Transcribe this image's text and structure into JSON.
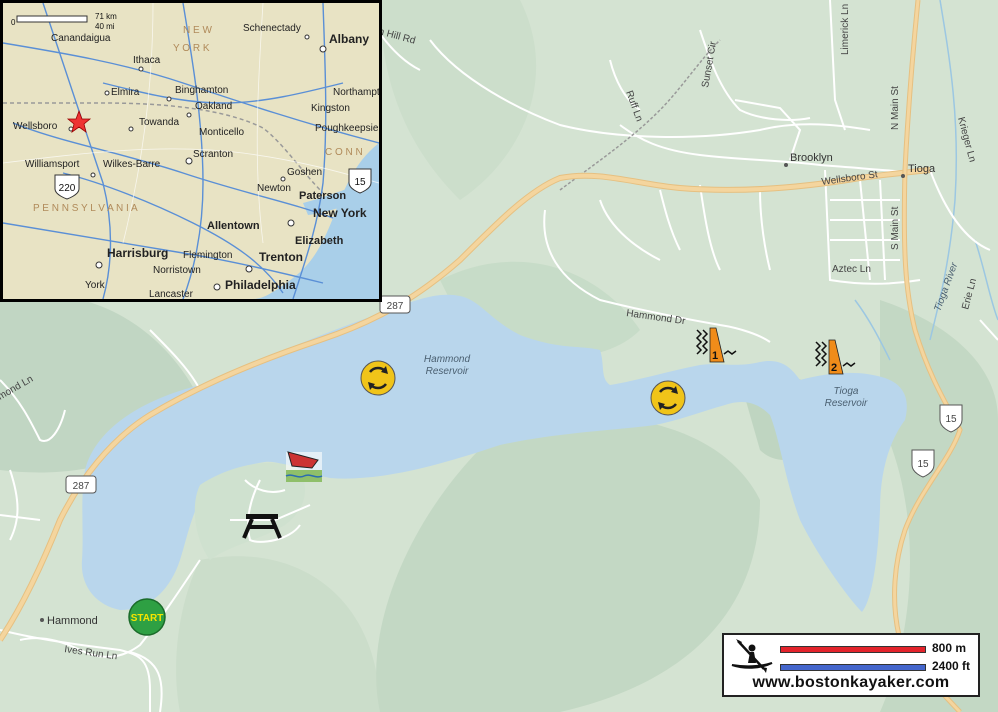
{
  "map": {
    "places": {
      "hammond": "Hammond",
      "brooklyn": "Brooklyn",
      "tioga": "Tioga"
    },
    "water": {
      "hammond_res_line1": "Hammond",
      "hammond_res_line2": "Reservoir",
      "tioga_res_line1": "Tioga",
      "tioga_res_line2": "Reservoir",
      "tioga_river": "Tioga River"
    },
    "roads": {
      "hammond_dr": "Hammond Dr",
      "ives_run": "Ives Run Ln",
      "wellsboro_st": "Wellsboro St",
      "n_main_st": "N Main St",
      "s_main_st": "S Main St",
      "aztec_ln": "Aztec Ln",
      "erie_ln": "Erie Ln",
      "krieger_ln": "Krieger Ln",
      "limerick_ln": "Limerick Ln",
      "sunset_cir": "Sunset Cir",
      "ruff_ln": "Ruff Ln",
      "hill_rd": "n Hill Rd",
      "hammond_ln": "mond Ln",
      "route_287": "287",
      "route_15": "15"
    },
    "markers": {
      "start": "START",
      "dam1": "1",
      "dam2": "2"
    }
  },
  "inset": {
    "scale_km": "71 km",
    "scale_mi": "40 mi",
    "scale_zero": "0",
    "states": {
      "new_york": "N E W",
      "york": "Y O R K",
      "pennsylvania": "P E N N S Y L V A N I A",
      "conn": "C O N N"
    },
    "cities": {
      "canandaigua": "Canandaigua",
      "schenectady": "Schenectady",
      "albany": "Albany",
      "ithaca": "Ithaca",
      "elmira": "Elmira",
      "binghamton": "Binghamton",
      "oakland": "Oakland",
      "northampton": "Northampton",
      "kingston": "Kingston",
      "poughkeepsie": "Poughkeepsie",
      "wellsboro": "Wellsboro",
      "towanda": "Towanda",
      "monticello": "Monticello",
      "williamsport": "Williamsport",
      "wilkes_barre": "Wilkes-Barre",
      "scranton": "Scranton",
      "goshen": "Goshen",
      "newton": "Newton",
      "paterson": "Paterson",
      "new_york_city": "New York",
      "allentown": "Allentown",
      "elizabeth": "Elizabeth",
      "harrisburg": "Harrisburg",
      "flemington": "Flemington",
      "trenton": "Trenton",
      "norristown": "Norristown",
      "york_city": "York",
      "lancaster": "Lancaster",
      "philadelphia": "Philadelphia"
    },
    "routes": {
      "us220": "220",
      "us15": "15"
    }
  },
  "legend": {
    "scale_m": "800 m",
    "scale_ft": "2400 ft",
    "website": "www.bostonkayaker.com",
    "colors": {
      "metric": "#e3232b",
      "imperial": "#4466cc"
    }
  }
}
